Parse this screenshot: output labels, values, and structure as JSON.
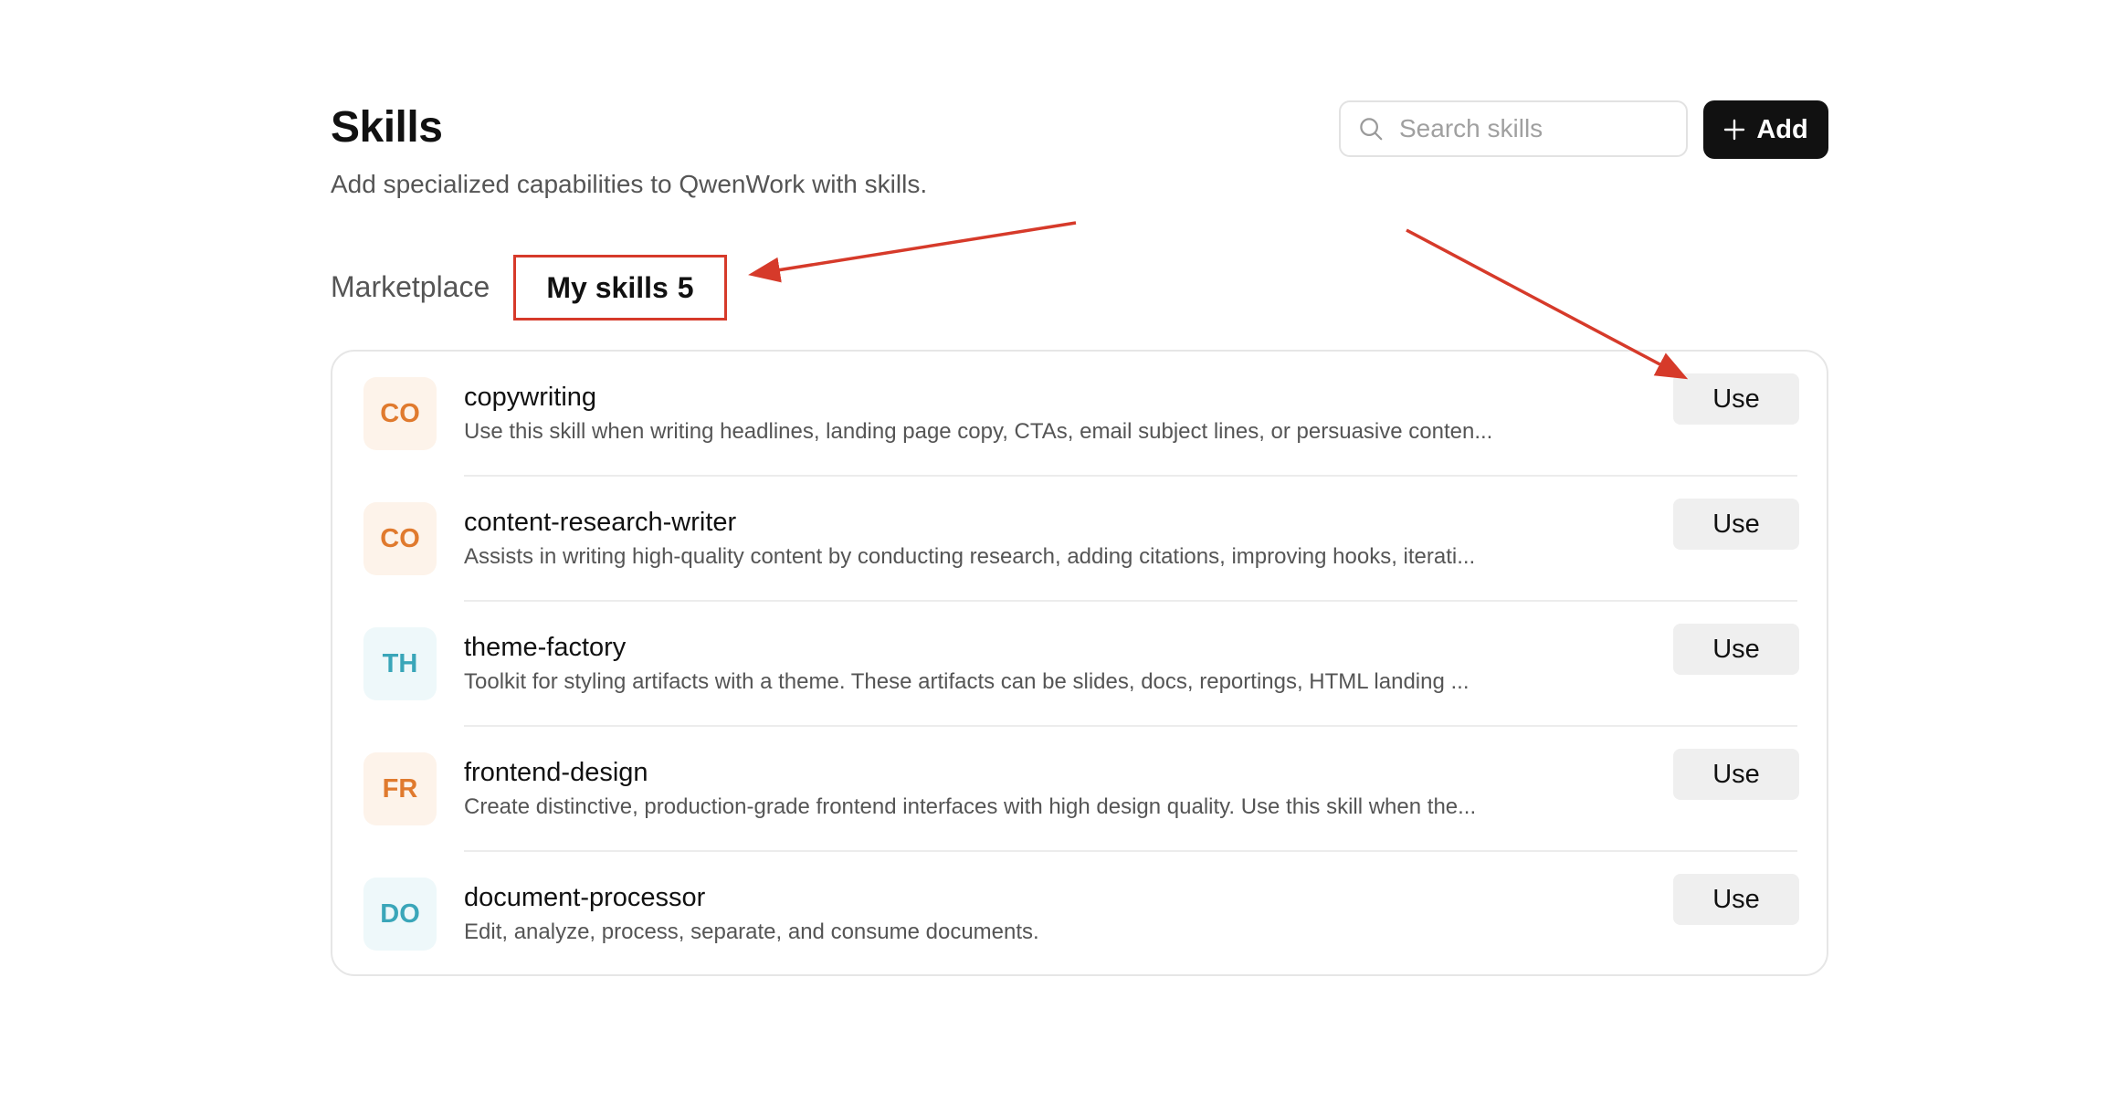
{
  "header": {
    "title": "Skills",
    "subtitle": "Add specialized capabilities to QwenWork with skills."
  },
  "search": {
    "placeholder": "Search skills",
    "value": "",
    "icon": "search-icon"
  },
  "add_button": {
    "label": "Add",
    "icon": "plus-icon"
  },
  "tabs": [
    {
      "label": "Marketplace",
      "active": false
    },
    {
      "label": "My skills",
      "count": "5",
      "active": true
    }
  ],
  "skills": [
    {
      "initials": "CO",
      "name": "copywriting",
      "description": "Use this skill when writing headlines, landing page copy, CTAs, email subject lines, or persuasive conten...",
      "action": "Use",
      "color": "#e07a2e",
      "bg": "#fdf3ea"
    },
    {
      "initials": "CO",
      "name": "content-research-writer",
      "description": "Assists in writing high-quality content by conducting research, adding citations, improving hooks, iterati...",
      "action": "Use",
      "color": "#e07a2e",
      "bg": "#fdf3ea"
    },
    {
      "initials": "TH",
      "name": "theme-factory",
      "description": "Toolkit for styling artifacts with a theme. These artifacts can be slides, docs, reportings, HTML landing ...",
      "action": "Use",
      "color": "#3aa6b9",
      "bg": "#eef8fa"
    },
    {
      "initials": "FR",
      "name": "frontend-design",
      "description": "Create distinctive, production-grade frontend interfaces with high design quality. Use this skill when the...",
      "action": "Use",
      "color": "#e07a2e",
      "bg": "#fdf3ea"
    },
    {
      "initials": "DO",
      "name": "document-processor",
      "description": "Edit, analyze, process, separate, and consume documents.",
      "action": "Use",
      "color": "#3aa6b9",
      "bg": "#eef8fa"
    }
  ],
  "annotations": {
    "arrow_color": "#d63a2a",
    "highlight_color": "#d63a2a"
  }
}
